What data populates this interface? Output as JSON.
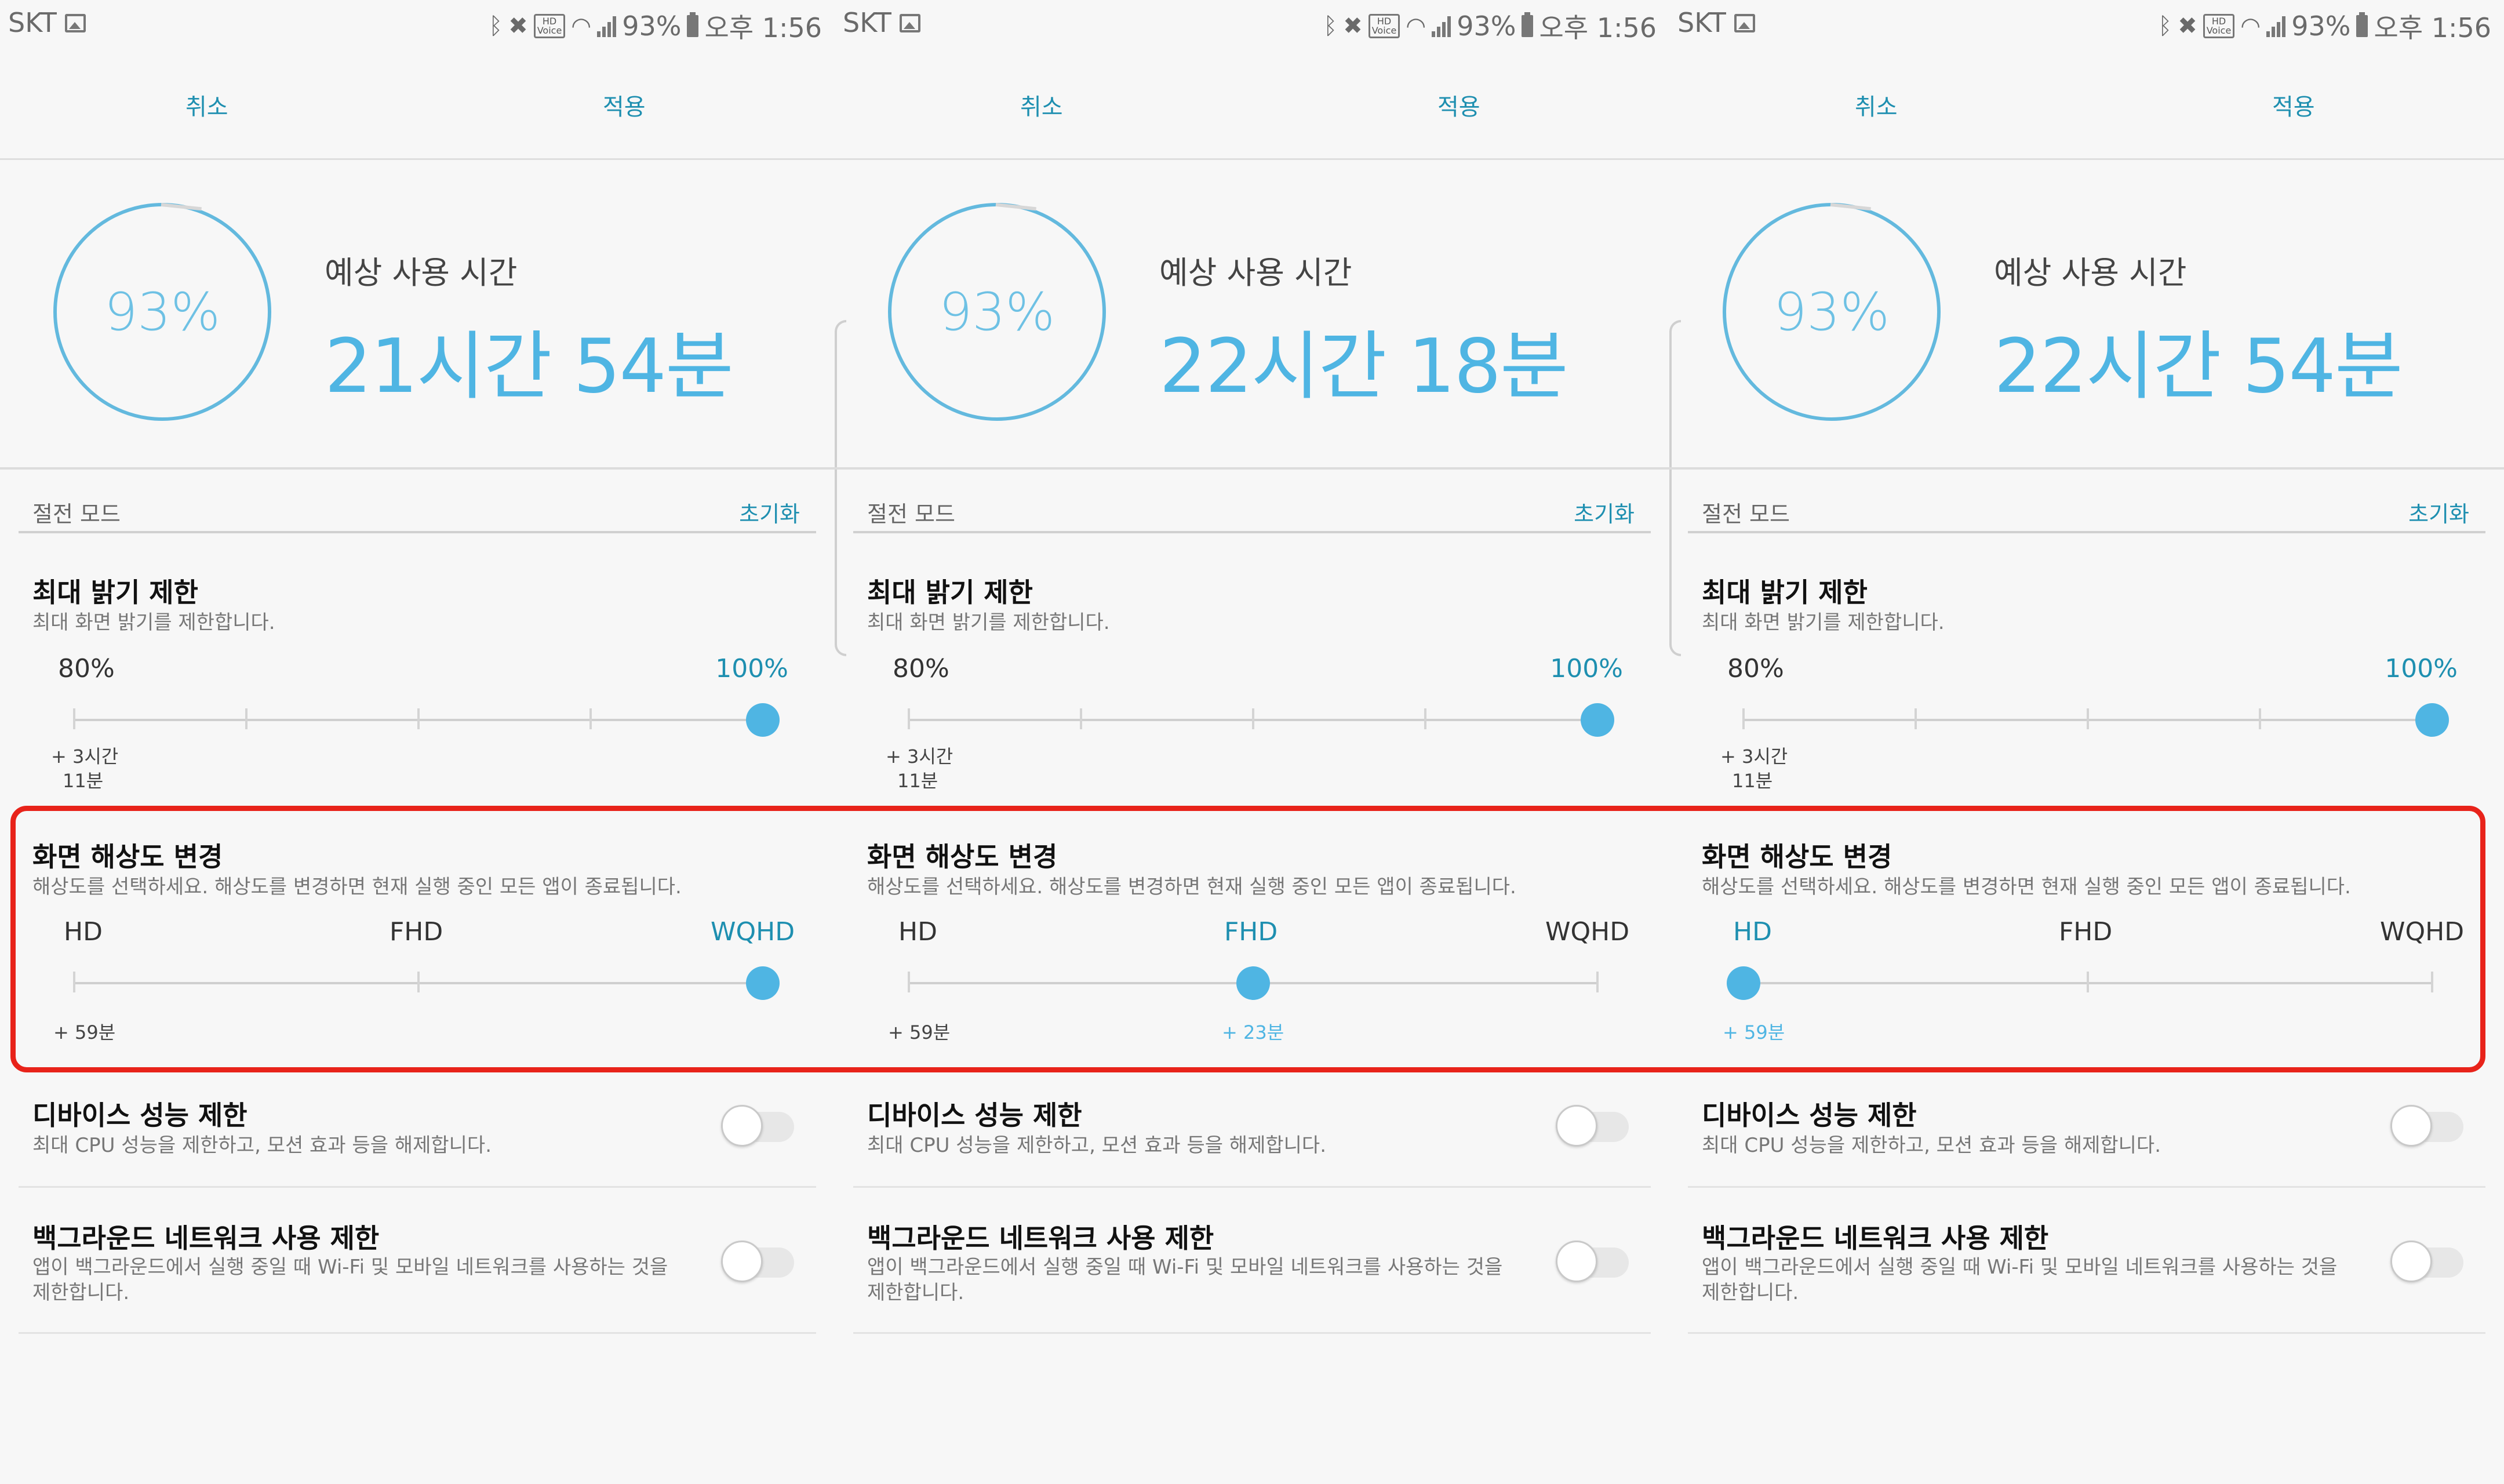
{
  "status_bar": {
    "carrier": "SKT",
    "hd_badge": "HD\nVoice",
    "battery_pct": "93%",
    "time": "오후 1:56"
  },
  "action_bar": {
    "cancel_label": "취소",
    "apply_label": "적용"
  },
  "battery": {
    "level_text": "93%",
    "usage_label": "예상 사용 시간"
  },
  "section": {
    "title": "절전 모드",
    "reset_label": "초기화"
  },
  "brightness": {
    "title": "최대 밝기 제한",
    "desc": "최대 화면 밝기를 제한합니다.",
    "min_label": "80%",
    "max_label": "100%",
    "note_line1": "+ 3시간",
    "note_line2": "11분"
  },
  "resolution": {
    "title": "화면 해상도 변경",
    "desc": "해상도를 선택하세요. 해상도를 변경하면 현재 실행 중인 모든 앱이 종료됩니다.",
    "options": [
      "HD",
      "FHD",
      "WQHD"
    ]
  },
  "performance": {
    "title": "디바이스 성능 제한",
    "desc": "최대 CPU 성능을 제한하고, 모션 효과 등을 해제합니다."
  },
  "background_network": {
    "title": "백그라운드 네트워크 사용 제한",
    "desc_line1": "앱이 백그라운드에서 실행 중일 때 Wi-Fi 및 모바일 네트워크를 사용하는 것을",
    "desc_line2": "제한합니다."
  },
  "colors": {
    "accent": "#4fb5e3",
    "link": "#1e8fb0",
    "highlight": "#e8231a"
  },
  "panels": [
    {
      "usage_value": "21시간 54분",
      "resolution_selected": "WQHD",
      "resolution_position": 1.0,
      "note_hd": "+ 59분",
      "note_selected": "",
      "brightness_position": 1.0
    },
    {
      "usage_value": "22시간 18분",
      "resolution_selected": "FHD",
      "resolution_position": 0.5,
      "note_hd": "+ 59분",
      "note_selected": "+ 23분",
      "brightness_position": 1.0
    },
    {
      "usage_value": "22시간 54분",
      "resolution_selected": "HD",
      "resolution_position": 0.0,
      "note_hd": "+ 59분",
      "note_selected": "",
      "brightness_position": 1.0
    }
  ]
}
